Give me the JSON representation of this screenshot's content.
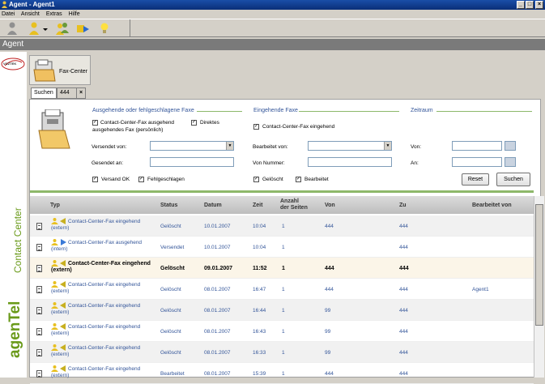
{
  "window": {
    "title": "Agent - Agent1",
    "buttons": [
      "_",
      "□",
      "×"
    ]
  },
  "menu": [
    "Datei",
    "Ansicht",
    "Extras",
    "Hilfe"
  ],
  "toolbar": {
    "icons": [
      "agent-gray-icon",
      "agent-yellow-icon",
      "agent-group-icon",
      "forward-icon",
      "lightbulb-icon"
    ]
  },
  "agent_bar": {
    "label": "Agent"
  },
  "brand": {
    "vendor": "VOZTEK",
    "product": "agenTel",
    "sub": "Contact Center"
  },
  "faxcenter_tab": {
    "label": "Fax-Center"
  },
  "subtabs": {
    "search": "Suchen",
    "tab": "444",
    "close": "×"
  },
  "filter": {
    "section_outgoing": "Ausgehende oder fehlgeschlagene Faxe",
    "section_incoming": "Eingehende Faxe",
    "section_period": "Zeitraum",
    "cb_cc_out": "Contact-Center-Fax ausgehend",
    "cb_direct": "Direktes",
    "cb_direct_sub": "ausgehendes Fax (persönlich)",
    "cb_cc_in": "Contact-Center-Fax eingehend",
    "sent_by": "Versendet von:",
    "sent_to": "Gesendet an:",
    "edited_by": "Bearbeitet von:",
    "from_number": "Von Nummer:",
    "from": "Von:",
    "to": "An:",
    "cb_sent_ok": "Versand OK",
    "cb_failed": "Fehlgeschlagen",
    "cb_deleted": "Gelöscht",
    "cb_edited": "Bearbeitet",
    "reset": "Reset",
    "search": "Suchen"
  },
  "table": {
    "headers": {
      "typ": "Typ",
      "status": "Status",
      "datum": "Datum",
      "zeit": "Zeit",
      "seiten": "Anzahl der Seiten",
      "von": "Von",
      "zu": "Zu",
      "bearbeitet": "Bearbeitet von"
    },
    "rows": [
      {
        "typ": "Contact-Center-Fax eingehend (extern)",
        "status": "Gelöscht",
        "datum": "10.01.2007",
        "zeit": "10:04",
        "seiten": "1",
        "von": "444",
        "zu": "444",
        "bearbeitet": ""
      },
      {
        "typ": "Contact-Center-Fax ausgehend (intern)",
        "status": "Versendet",
        "datum": "10.01.2007",
        "zeit": "10:04",
        "seiten": "1",
        "von": "",
        "zu": "444",
        "bearbeitet": ""
      },
      {
        "typ": "Contact-Center-Fax eingehend (extern)",
        "status": "Gelöscht",
        "datum": "09.01.2007",
        "zeit": "11:52",
        "seiten": "1",
        "von": "444",
        "zu": "444",
        "bearbeitet": ""
      },
      {
        "typ": "Contact-Center-Fax eingehend (extern)",
        "status": "Gelöscht",
        "datum": "08.01.2007",
        "zeit": "16:47",
        "seiten": "1",
        "von": "444",
        "zu": "444",
        "bearbeitet": "Agent1"
      },
      {
        "typ": "Contact-Center-Fax eingehend (extern)",
        "status": "Gelöscht",
        "datum": "08.01.2007",
        "zeit": "16:44",
        "seiten": "1",
        "von": "99",
        "zu": "444",
        "bearbeitet": ""
      },
      {
        "typ": "Contact-Center-Fax eingehend (extern)",
        "status": "Gelöscht",
        "datum": "08.01.2007",
        "zeit": "16:43",
        "seiten": "1",
        "von": "99",
        "zu": "444",
        "bearbeitet": ""
      },
      {
        "typ": "Contact-Center-Fax eingehend (extern)",
        "status": "Gelöscht",
        "datum": "08.01.2007",
        "zeit": "16:33",
        "seiten": "1",
        "von": "99",
        "zu": "444",
        "bearbeitet": ""
      },
      {
        "typ": "Contact-Center-Fax eingehend (extern)",
        "status": "Bearbeitet",
        "datum": "08.01.2007",
        "zeit": "15:39",
        "seiten": "1",
        "von": "444",
        "zu": "444",
        "bearbeitet": ""
      }
    ]
  }
}
